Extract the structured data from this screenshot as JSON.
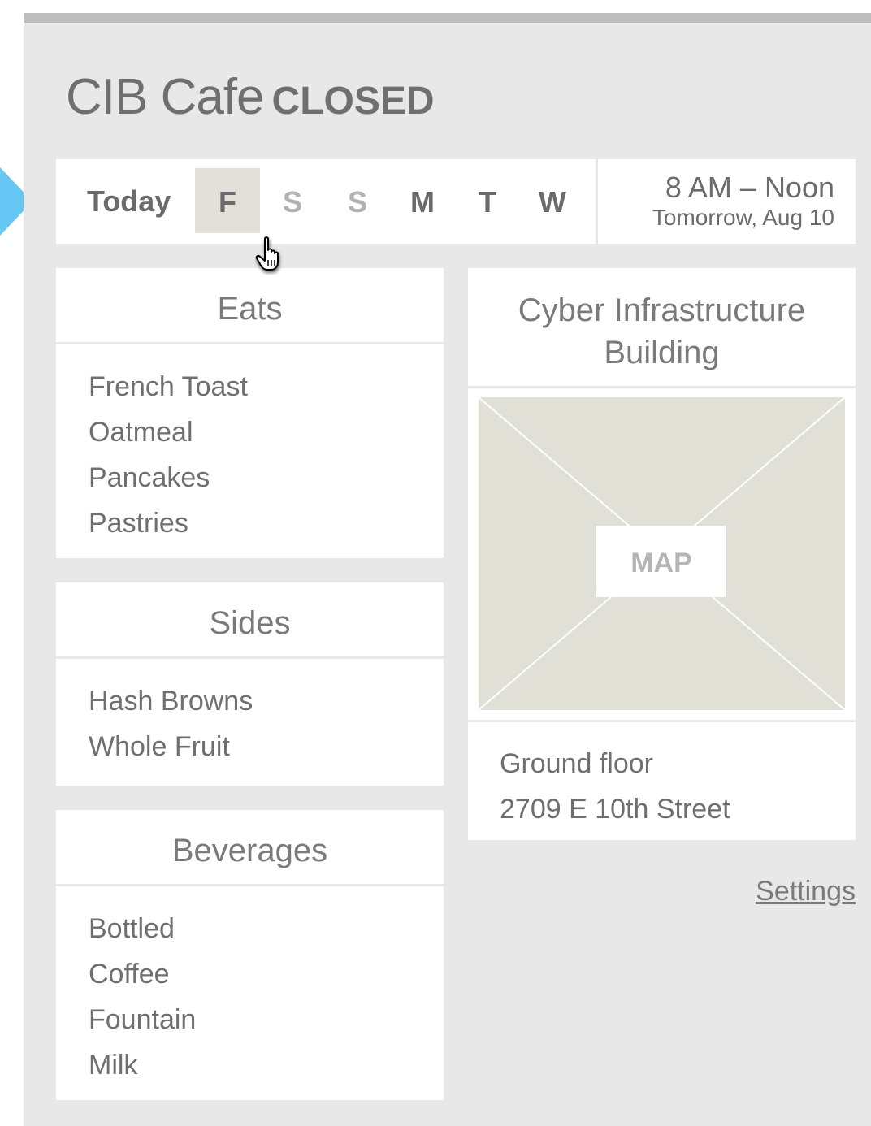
{
  "header": {
    "cafe_name": "CIB Cafe",
    "status": "CLOSED"
  },
  "day_selector": {
    "today_label": "Today",
    "days": [
      {
        "label": "F",
        "state": "selected"
      },
      {
        "label": "S",
        "state": "muted"
      },
      {
        "label": "S",
        "state": "muted"
      },
      {
        "label": "M",
        "state": "normal"
      },
      {
        "label": "T",
        "state": "normal"
      },
      {
        "label": "W",
        "state": "normal"
      }
    ]
  },
  "hours": {
    "time": "8 AM – Noon",
    "date": "Tomorrow, Aug 10"
  },
  "menu": [
    {
      "heading": "Eats",
      "items": [
        "French Toast",
        "Oatmeal",
        "Pancakes",
        "Pastries"
      ]
    },
    {
      "heading": "Sides",
      "items": [
        "Hash Browns",
        "Whole Fruit"
      ]
    },
    {
      "heading": "Beverages",
      "items": [
        "Bottled",
        "Coffee",
        "Fountain",
        "Milk"
      ]
    }
  ],
  "location": {
    "building_line1": "Cyber Infrastructure",
    "building_line2": "Building",
    "map_label": "MAP",
    "floor": "Ground floor",
    "street": "2709 E 10th Street"
  },
  "settings_label": "Settings",
  "colors": {
    "accent_arrow": "#66c6f4",
    "panel_bg": "#e8e8e8",
    "selected_day_bg": "#e1e1d9",
    "map_bg": "#e0e0d7"
  }
}
